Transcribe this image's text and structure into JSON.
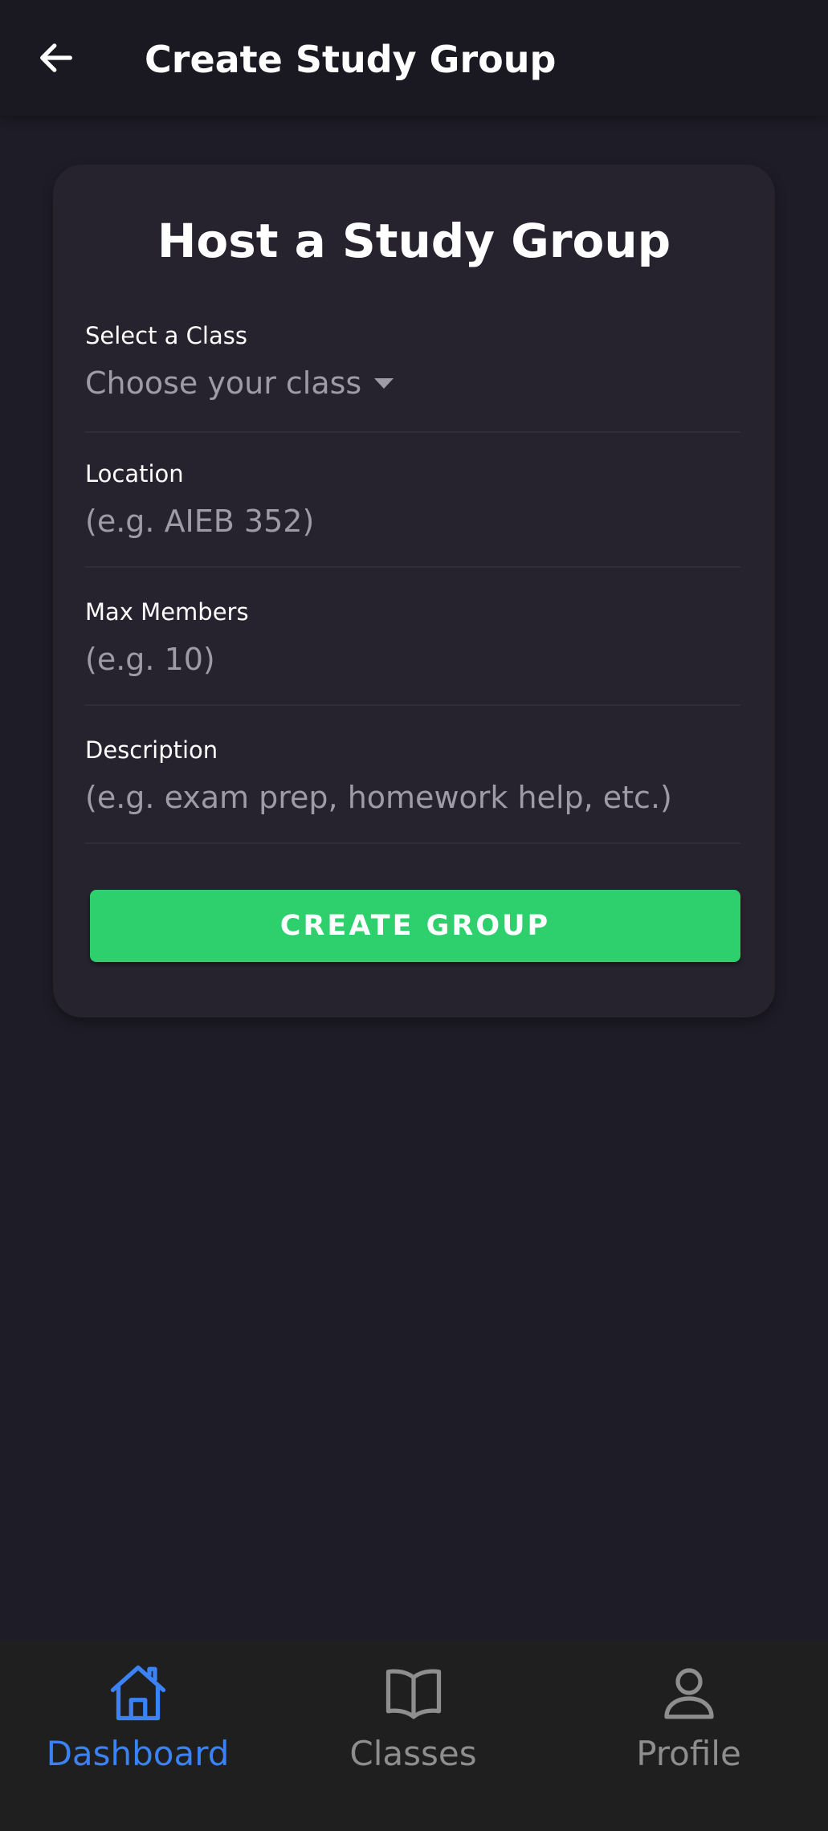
{
  "header": {
    "title": "Create Study Group",
    "back_icon": "arrow-left-icon"
  },
  "form": {
    "title": "Host a Study Group",
    "class_field": {
      "label": "Select a Class",
      "placeholder": "Choose your class",
      "icon": "caret-down-icon"
    },
    "location_field": {
      "label": "Location",
      "placeholder": "(e.g. AIEB 352)"
    },
    "max_members_field": {
      "label": "Max Members",
      "placeholder": "(e.g. 10)"
    },
    "description_field": {
      "label": "Description",
      "placeholder": "(e.g. exam prep, homework help, etc.)"
    },
    "submit_label": "CREATE GROUP"
  },
  "bottom_nav": {
    "items": [
      {
        "label": "Dashboard",
        "icon": "home-icon",
        "active": true
      },
      {
        "label": "Classes",
        "icon": "book-icon",
        "active": false
      },
      {
        "label": "Profile",
        "icon": "user-icon",
        "active": false
      }
    ]
  },
  "colors": {
    "background": "#1e1c27",
    "card": "#26232f",
    "accent_green": "#2ed06e",
    "active_nav": "#3b82f6",
    "inactive_nav": "#8e8e8e"
  }
}
